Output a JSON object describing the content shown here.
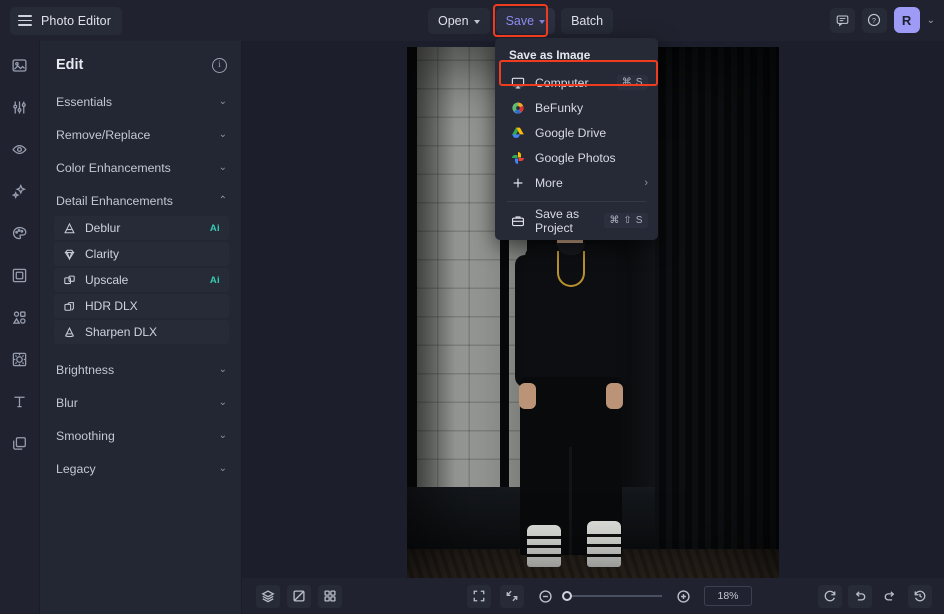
{
  "app": {
    "title": "Photo Editor",
    "menu_icon": "hamburger-icon"
  },
  "toolbar": {
    "open_label": "Open",
    "save_label": "Save",
    "batch_label": "Batch",
    "feedback_icon": "chat-icon",
    "help_icon": "question-circle-icon",
    "avatar_initial": "R",
    "account_caret": "⌄",
    "accent_color": "#8f8df0",
    "highlight_color": "#f03c1e"
  },
  "rail": {
    "items": [
      {
        "name": "image-icon"
      },
      {
        "name": "sliders-icon"
      },
      {
        "name": "eye-icon"
      },
      {
        "name": "sparkles-icon"
      },
      {
        "name": "palette-icon"
      },
      {
        "name": "frame-icon"
      },
      {
        "name": "shapes-icon"
      },
      {
        "name": "texture-icon"
      },
      {
        "name": "text-icon"
      },
      {
        "name": "layers-icon"
      }
    ]
  },
  "sidebar": {
    "title": "Edit",
    "info_icon": "info-icon",
    "groups": [
      {
        "label": "Essentials",
        "expanded": false,
        "chevron": "⌄"
      },
      {
        "label": "Remove/Replace",
        "expanded": false,
        "chevron": "⌄"
      },
      {
        "label": "Color Enhancements",
        "expanded": false,
        "chevron": "⌄"
      },
      {
        "label": "Detail Enhancements",
        "expanded": true,
        "chevron": "⌃"
      },
      {
        "label": "Brightness",
        "expanded": false,
        "chevron": "⌄"
      },
      {
        "label": "Blur",
        "expanded": false,
        "chevron": "⌄"
      },
      {
        "label": "Smoothing",
        "expanded": false,
        "chevron": "⌄"
      },
      {
        "label": "Legacy",
        "expanded": false,
        "chevron": "⌄"
      }
    ],
    "detail_items": [
      {
        "label": "Deblur",
        "icon": "deblur-icon",
        "badge": "Ai"
      },
      {
        "label": "Clarity",
        "icon": "diamond-icon",
        "badge": ""
      },
      {
        "label": "Upscale",
        "icon": "upscale-icon",
        "badge": "Ai"
      },
      {
        "label": "HDR DLX",
        "icon": "hdr-icon",
        "badge": ""
      },
      {
        "label": "Sharpen DLX",
        "icon": "sharpen-icon",
        "badge": ""
      }
    ],
    "ai_badge_color": "#35cdb4"
  },
  "save_menu": {
    "title": "Save as Image",
    "items": [
      {
        "label": "Computer",
        "icon": "monitor-icon",
        "shortcut": "⌘ S",
        "highlighted": true
      },
      {
        "label": "BeFunky",
        "icon": "befunky-logo-icon",
        "shortcut": "",
        "highlighted": false
      },
      {
        "label": "Google Drive",
        "icon": "google-drive-icon",
        "shortcut": "",
        "highlighted": false
      },
      {
        "label": "Google Photos",
        "icon": "google-photos-icon",
        "shortcut": "",
        "highlighted": false
      },
      {
        "label": "More",
        "icon": "plus-icon",
        "shortcut": "",
        "submenu_arrow": "›",
        "highlighted": false
      }
    ],
    "project_item": {
      "label": "Save as Project",
      "icon": "briefcase-icon",
      "shortcut": "⌘ ⇧ S"
    }
  },
  "bottombar": {
    "left_tools": [
      {
        "name": "layers-stack-icon"
      },
      {
        "name": "compare-icon"
      },
      {
        "name": "grid-icon"
      }
    ],
    "view_tools": [
      {
        "name": "fit-screen-icon"
      },
      {
        "name": "actual-size-icon"
      }
    ],
    "zoom_out_icon": "minus-circle-icon",
    "zoom_in_icon": "plus-circle-icon",
    "zoom_value": "18%",
    "zoom_slider_percent": 8,
    "right_tools": [
      {
        "name": "reset-icon"
      },
      {
        "name": "undo-icon"
      },
      {
        "name": "redo-icon"
      },
      {
        "name": "history-icon"
      }
    ]
  },
  "canvas": {
    "photo_alt": "man-in-black-outfit-leaning-on-tiled-wall"
  }
}
